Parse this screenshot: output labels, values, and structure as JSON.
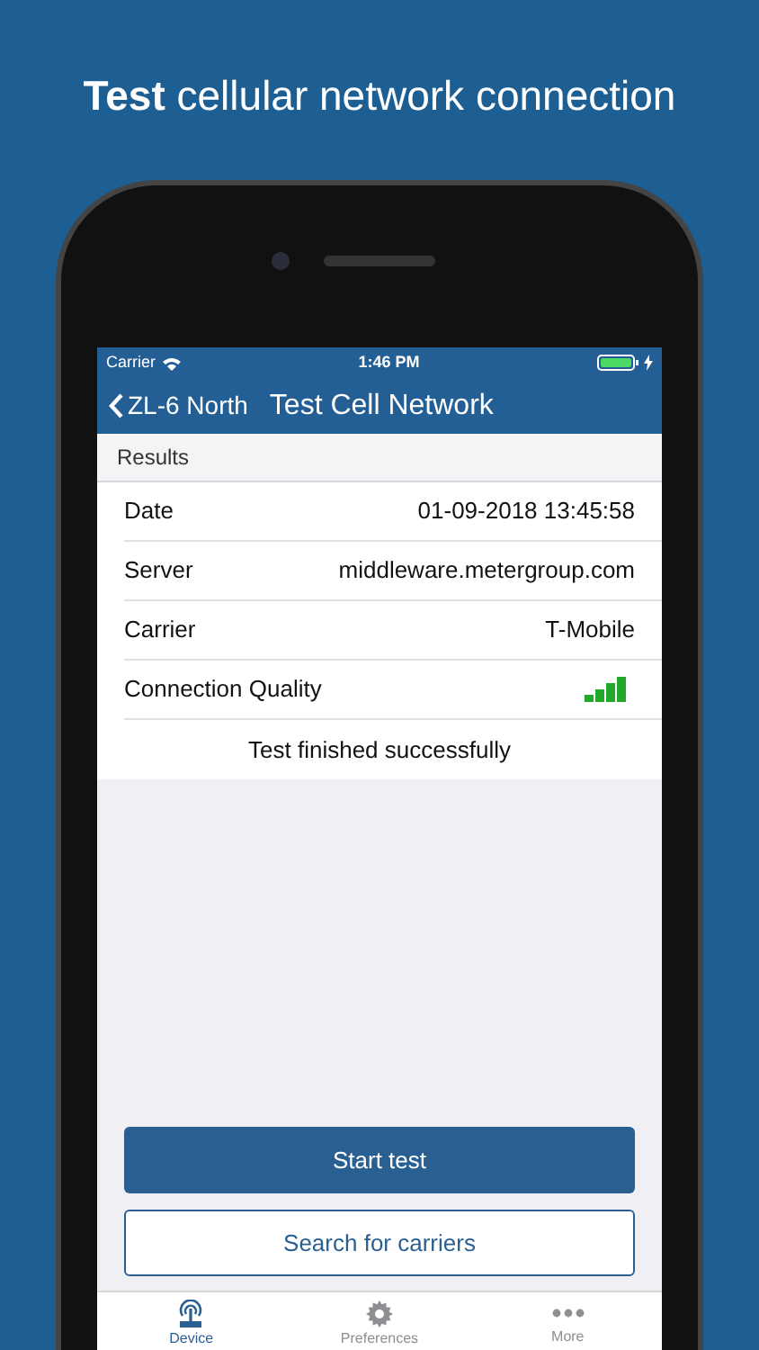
{
  "headline": "**Test** cellular network connection",
  "status_bar": {
    "carrier": "Carrier",
    "time": "1:46 PM"
  },
  "nav": {
    "back": "ZL-6 North",
    "title": "Test Cell Network"
  },
  "section": "Results",
  "rows": [
    {
      "kind": "text",
      "label": "Date",
      "value": "01-09-2018 13:45:58"
    },
    {
      "kind": "text",
      "label": "Server",
      "value": "middleware.metergroup.com"
    },
    {
      "kind": "text",
      "label": "Carrier",
      "value": "T-Mobile"
    },
    {
      "kind": "signal",
      "label": "Connection Quality"
    }
  ],
  "message": "Test finished successfully",
  "buttons": [
    {
      "kind": "primary",
      "label": "Start test"
    },
    {
      "kind": "outline",
      "label": "Search for carriers"
    }
  ],
  "tabs": [
    {
      "kind": "device",
      "label": "Device",
      "selected": true
    },
    {
      "kind": "gear",
      "label": "Preferences",
      "selected": false
    },
    {
      "kind": "more",
      "label": "More",
      "selected": false
    }
  ]
}
